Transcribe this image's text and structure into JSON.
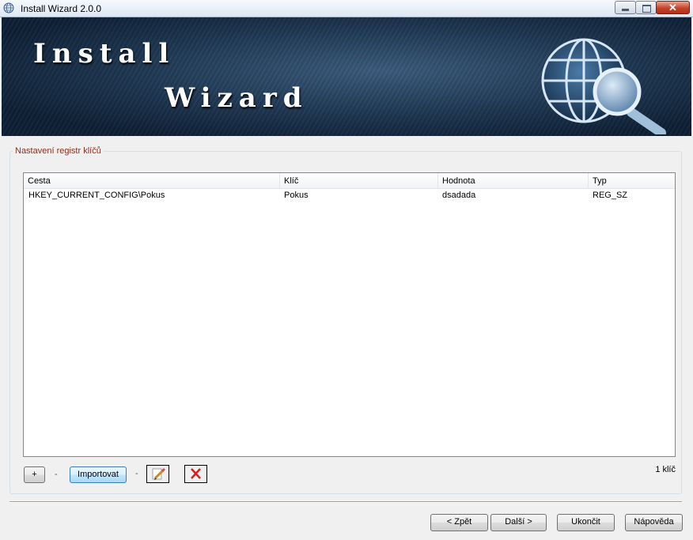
{
  "window": {
    "title": "Install Wizard 2.0.0",
    "controls": {
      "minimize": "minimize-icon",
      "maximize": "maximize-icon",
      "close": "✕"
    }
  },
  "banner": {
    "line1": "Install",
    "line2": "Wizard",
    "emblem": "globe-magnifier-icon"
  },
  "group": {
    "label": "Nastavení registr klíčů"
  },
  "table": {
    "columns": [
      "Cesta",
      "Klíč",
      "Hodnota",
      "Typ"
    ],
    "rows": [
      [
        "HKEY_CURRENT_CONFIG\\Pokus",
        "Pokus",
        "dsadada",
        "REG_SZ"
      ]
    ]
  },
  "toolbar": {
    "add_label": "+",
    "separator": "-",
    "import_label": "Importovat",
    "edit_icon": "pencil-icon",
    "delete_icon": "delete-icon",
    "count": "1 klíč"
  },
  "footer": {
    "back": "< Zpět",
    "next": "Další >",
    "finish": "Ukončit",
    "help": "Nápověda"
  },
  "colors": {
    "group_label": "#8b2e1e",
    "banner_dark": "#0e2035",
    "close_button": "#c5432c"
  }
}
